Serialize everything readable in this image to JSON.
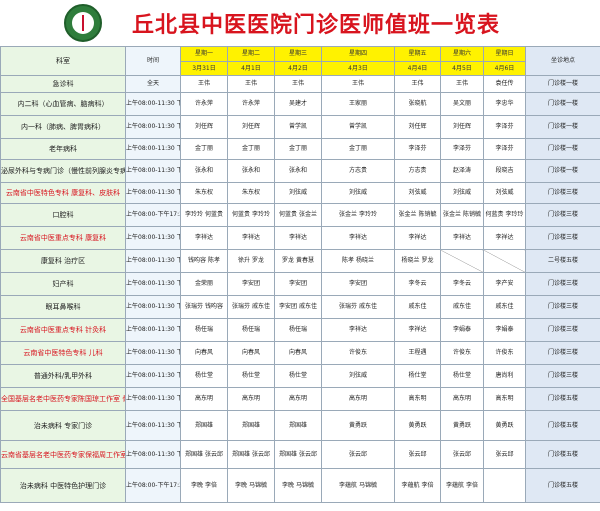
{
  "title": "丘北县中医医院门诊医师值班一览表",
  "header": {
    "dept": "科室",
    "time": "时间",
    "loc": "坐诊地点",
    "weekdays": [
      "星期一",
      "星期二",
      "星期三",
      "星期四",
      "星期五",
      "星期六",
      "星期日"
    ],
    "dates": [
      "3月31日",
      "4月1日",
      "4月2日",
      "4月3日",
      "4月4日",
      "4月5日",
      "4月6日"
    ]
  },
  "rows": [
    {
      "dept": "急诊科",
      "time": "全天",
      "days": [
        "王伟",
        "王伟",
        "王伟",
        "王伟",
        "王伟",
        "王伟",
        "袁任传"
      ],
      "loc": "门诊楼一楼"
    },
    {
      "dept": "内二科（心血管病、脑病科）",
      "time": "上午08:00-11:30 下午14:00-17:30",
      "days": [
        "许永萍",
        "许永萍",
        "吴建才",
        "王家丽",
        "张晓航",
        "吴文丽",
        "李忠华"
      ],
      "loc": "门诊楼一楼"
    },
    {
      "dept": "内一科（肺病、脾胃病科）",
      "time": "上午08:00-11:30 下午14:00-17:30",
      "days": [
        "刘任辉",
        "刘任辉",
        "曾学凯",
        "曾学凯",
        "刘任辉",
        "刘任辉",
        "李泽芬"
      ],
      "loc": "门诊楼一楼"
    },
    {
      "dept": "老年病科",
      "time": "上午08:00-11:30 下午14:00-17:30",
      "days": [
        "金丁丽",
        "金丁丽",
        "金丁丽",
        "金丁丽",
        "李泽芬",
        "李泽芬",
        "李泽芬"
      ],
      "loc": "门诊楼一楼"
    },
    {
      "dept": "泌尿外科与专病门诊（慢性前列腺炎专病门诊）",
      "time": "上午08:00-11:30 下午14:00-17:30",
      "days": [
        "张永和",
        "张永和",
        "张永和",
        "方志贵",
        "方志贵",
        "赵泽涛",
        "段晓吉"
      ],
      "loc": "门诊楼一楼"
    },
    {
      "dept": "云南省中医特色专科 康复科、皮肤科",
      "time": "上午08:00-11:30 下午14:00-17:30",
      "days": [
        "朱东权",
        "朱东权",
        "刘弦威",
        "刘弦威",
        "刘弦威",
        "刘弦威",
        "刘弦威"
      ],
      "loc": "门诊楼三楼"
    },
    {
      "dept": "口腔科",
      "time": "上午08:00-下午17:30",
      "days": [
        "李玲玲 何蓝贵",
        "何蓝贵 李玲玲",
        "何蓝贵 张金兰",
        "张金兰 李玲玲",
        "张金兰 陈销毓",
        "张金兰 陈销毓",
        "何蓝贵 李玲玲"
      ],
      "loc": "门诊楼三楼"
    },
    {
      "dept": "云南省中医重点专科 康复科",
      "time": "上午08:00-11:30 下午14:00-17:30",
      "days": [
        "李祥达",
        "李祥达",
        "李祥达",
        "李祥达",
        "李祥达",
        "李祥达",
        "李祥达"
      ],
      "loc": "门诊楼三楼"
    },
    {
      "dept": "康复科 治疗区",
      "time": "上午08:00-11:30 下午14:00-晚上21:00",
      "days": [
        "钱昀容 陈孝",
        "徐升 罗龙",
        "罗龙 黄春慧",
        "陈孝 杨晓兰",
        "杨晓兰 罗龙",
        "",
        ""
      ],
      "loc": "二号楼五楼"
    },
    {
      "dept": "妇产科",
      "time": "上午08:00-11:30 下午14:00-17:30",
      "days": [
        "金荣丽",
        "李安团",
        "李安团",
        "李安团",
        "李冬云",
        "李冬云",
        "李产安"
      ],
      "loc": "门诊楼三楼"
    },
    {
      "dept": "眼耳鼻喉科",
      "time": "上午08:00-11:30 下午14:00-17:30",
      "days": [
        "张瑞芬 钱昀容",
        "张瑞芬 戚东佳",
        "李安团 戚东佳",
        "张瑞芬 戚东佳",
        "戚东佳",
        "戚东佳",
        "戚东佳"
      ],
      "loc": "门诊楼三楼"
    },
    {
      "dept": "云南省中医重点专科 针灸科",
      "time": "上午08:00-11:30 下午14:00-17:30",
      "days": [
        "杨任瑞",
        "杨任瑞",
        "杨任瑞",
        "李祥达",
        "李祥达",
        "李娟泰",
        "李娟泰"
      ],
      "loc": "门诊楼三楼"
    },
    {
      "dept": "云南省中医特色专科 儿科",
      "time": "上午08:00-11:30 下午14:00-17:30",
      "days": [
        "向春风",
        "向春风",
        "向春风",
        "许俊东",
        "王程遇",
        "许俊东",
        "许俊东"
      ],
      "loc": "门诊楼三楼"
    },
    {
      "dept": "普通外科/乳甲外科",
      "time": "上午08:00-11:30 下午14:00-17:30",
      "days": [
        "杨仕堂",
        "杨仕堂",
        "杨仕堂",
        "刘弦威",
        "杨仕堂",
        "杨仕堂",
        "唐尚利"
      ],
      "loc": "门诊楼三楼"
    },
    {
      "dept": "全国基层名老中医药专家陈国琼工作室 骨伤科",
      "time": "上午08:00-11:30 下午14:00-17:30",
      "days": [
        "高东明",
        "高东明",
        "高东明",
        "高东明",
        "高东明",
        "高东明",
        "高东明"
      ],
      "loc": "门诊楼五楼"
    },
    {
      "dept": "治未病科 专家门诊",
      "time": "上午08:00-11:30 下午14:00-17:30",
      "days": [
        "郑国雄",
        "郑国雄",
        "郑国雄",
        "黄勇跃",
        "黄勇跃",
        "黄勇跃",
        "黄勇跃"
      ],
      "loc": "门诊楼五楼"
    },
    {
      "dept": "云南省基层名老中医药专家保福周工作室 治未病科",
      "time": "上午08:00-11:30 下午14:00-17:30",
      "days": [
        "郑国雄 张云邱",
        "郑国雄 张云邱",
        "郑国雄 张云邱",
        "张云邱",
        "张云邱",
        "张云邱",
        "张云邱"
      ],
      "loc": "门诊楼五楼"
    },
    {
      "dept": "治未病科 中医特色护理门诊",
      "time": "上午08:00-下午17:30",
      "days": [
        "李晚 李倍",
        "李晚 马锦毓",
        "李晚 马锦毓",
        "李蕴航 马锦毓",
        "李蕴航 李倍",
        "李蕴航 李倍",
        ""
      ],
      "loc": "门诊楼五楼"
    }
  ]
}
